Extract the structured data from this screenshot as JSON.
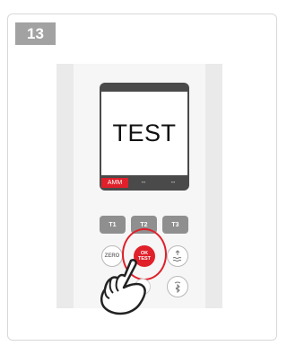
{
  "step": {
    "number": "13"
  },
  "display": {
    "text": "TEST",
    "softkeys": [
      "AMM",
      "--",
      "--"
    ]
  },
  "buttons": {
    "t1": "T1",
    "t2": "T2",
    "t3": "T3",
    "zero": "ZERO",
    "ok_line1": "OK",
    "ok_line2": "TEST"
  },
  "icons": [
    "tide-icon",
    "bluetooth-icon",
    "hand-pointer-icon"
  ],
  "colors": {
    "accent": "#e0202a",
    "badge": "#a2a2a2",
    "frame": "#4a4a4a",
    "key": "#8f8f8f"
  }
}
